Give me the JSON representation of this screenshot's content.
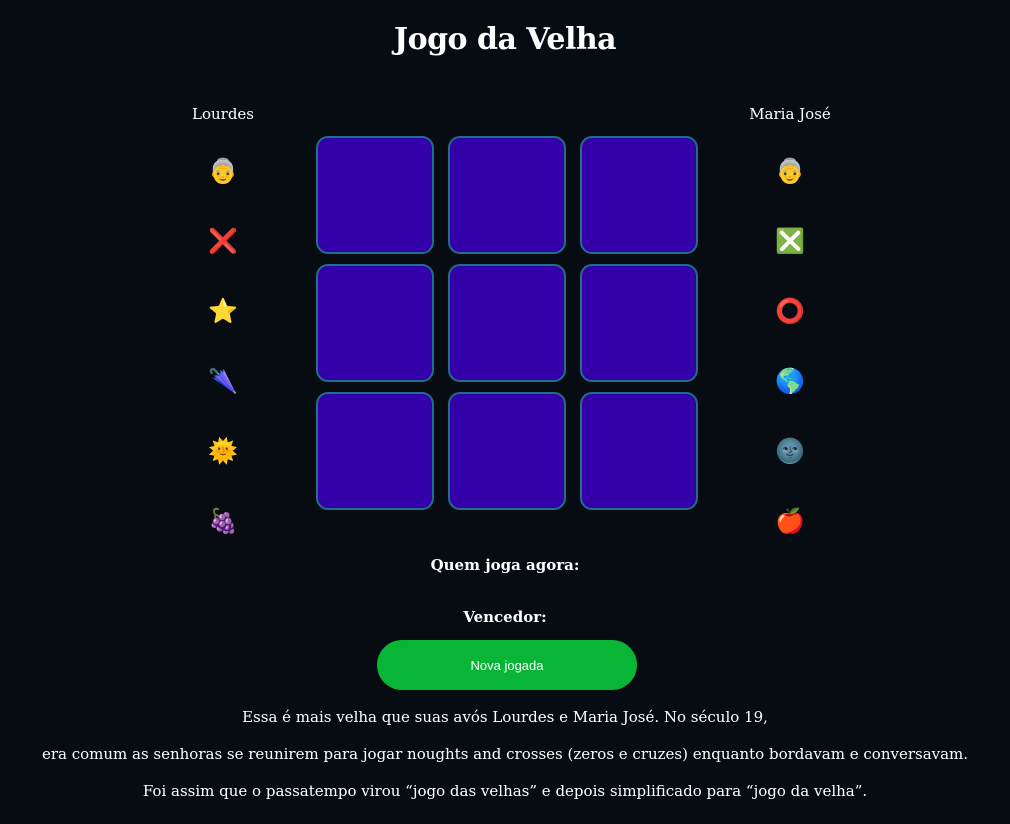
{
  "title": "Jogo da Velha",
  "players": [
    {
      "name": "Lourdes",
      "emojis": [
        {
          "glyph": "👵",
          "icon": "old-woman-icon"
        },
        {
          "glyph": "❌",
          "icon": "cross-mark-icon"
        },
        {
          "glyph": "⭐",
          "icon": "star-icon"
        },
        {
          "glyph": "🌂",
          "icon": "closed-umbrella-icon"
        },
        {
          "glyph": "🌞",
          "icon": "sun-with-face-icon"
        },
        {
          "glyph": "🍇",
          "icon": "grapes-icon"
        }
      ]
    },
    {
      "name": "Maria José",
      "emojis": [
        {
          "glyph": "👵",
          "icon": "old-woman-icon"
        },
        {
          "glyph": "❎",
          "icon": "cross-mark-button-icon"
        },
        {
          "glyph": "⭕",
          "icon": "hollow-circle-icon"
        },
        {
          "glyph": "🌎",
          "icon": "globe-icon"
        },
        {
          "glyph": "🌚",
          "icon": "new-moon-face-icon"
        },
        {
          "glyph": "🍎",
          "icon": "red-apple-icon"
        }
      ]
    }
  ],
  "board": {
    "cells": [
      "",
      "",
      "",
      "",
      "",
      "",
      "",
      "",
      ""
    ],
    "cell_color": "#3300aa",
    "cell_border_color": "#1e6f8a"
  },
  "status": {
    "current_player_label": "Quem joga agora:",
    "winner_label": "Vencedor:"
  },
  "new_game_label": "Nova jogada",
  "new_game_color": "#09b535",
  "background_color": "#070b12",
  "story": [
    "Essa é mais velha que suas avós Lourdes e Maria José. No século 19,",
    "era comum as senhoras se reunirem para jogar noughts and crosses (zeros e cruzes) enquanto bordavam e conversavam.",
    "Foi assim que o passatempo virou “jogo das velhas” e depois simplificado para “jogo da velha”."
  ]
}
